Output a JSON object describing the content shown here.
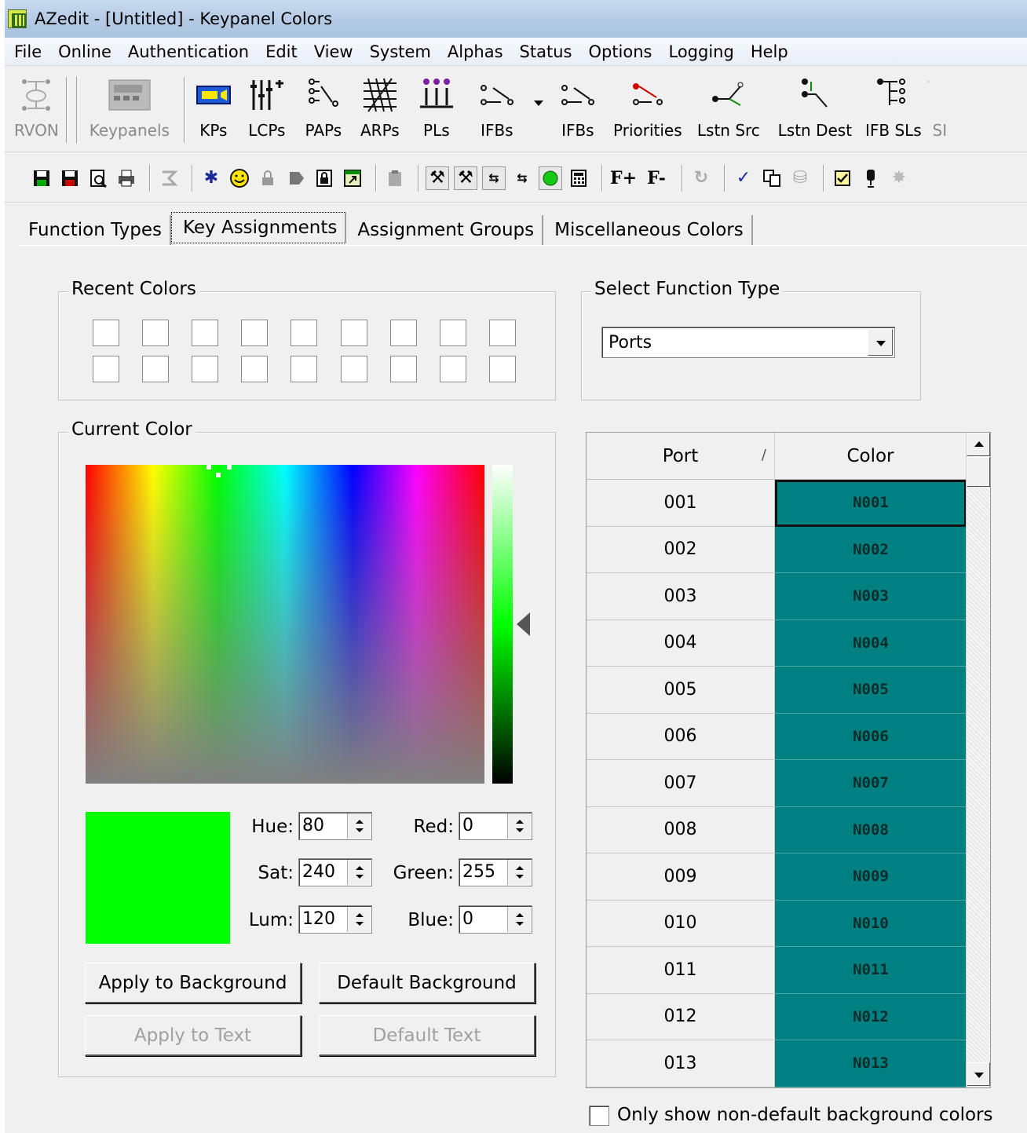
{
  "window": {
    "title": "AZedit - [Untitled] - Keypanel Colors"
  },
  "menu": [
    "File",
    "Online",
    "Authentication",
    "Edit",
    "View",
    "System",
    "Alphas",
    "Status",
    "Options",
    "Logging",
    "Help"
  ],
  "toolbar": {
    "buttons": [
      {
        "label": "RVON",
        "icon": "rvon-icon",
        "enabled": false
      },
      {
        "label": "Keypanels",
        "icon": "keypanels-icon",
        "enabled": false
      },
      {
        "label": "KPs",
        "icon": "kps-icon",
        "enabled": true
      },
      {
        "label": "LCPs",
        "icon": "lcps-icon",
        "enabled": true
      },
      {
        "label": "PAPs",
        "icon": "paps-icon",
        "enabled": true
      },
      {
        "label": "ARPs",
        "icon": "arps-icon",
        "enabled": true
      },
      {
        "label": "PLs",
        "icon": "pls-icon",
        "enabled": true
      },
      {
        "label": "IFBs",
        "icon": "ifbs-icon",
        "enabled": true
      },
      {
        "label": "IFBs",
        "icon": "ifbs-icon",
        "enabled": true
      },
      {
        "label": "Priorities",
        "icon": "priorities-icon",
        "enabled": true
      },
      {
        "label": "Lstn Src",
        "icon": "listen-source-icon",
        "enabled": true
      },
      {
        "label": "Lstn Dest",
        "icon": "listen-dest-icon",
        "enabled": true
      },
      {
        "label": "IFB SLs",
        "icon": "ifb-sls-icon",
        "enabled": true
      },
      {
        "label": "SI",
        "icon": "cut-off-icon",
        "enabled": false
      }
    ]
  },
  "small_toolbar": {
    "icons": [
      "save-icon",
      "save-as-icon",
      "print-preview-icon",
      "print-icon",
      "online-icon",
      "gear-icon",
      "smiley-icon",
      "lock-icon",
      "shape-icon",
      "locked-file-icon",
      "export-icon",
      "clipboard-icon",
      "hammer-icon",
      "hammer-add-icon",
      "routing-icon",
      "routing-add-icon",
      "green-dot-icon",
      "calculator-icon",
      "f-plus-icon",
      "f-minus-icon",
      "refresh-icon",
      "spellcheck-icon",
      "translate-icon",
      "server-icon",
      "checkbox-icon",
      "microphone-icon",
      "burst-icon"
    ],
    "text_buttons": {
      "f_plus": "F+",
      "f_minus": "F-"
    }
  },
  "tabs": [
    {
      "label": "Function Types",
      "active": false
    },
    {
      "label": "Key Assignments",
      "active": true
    },
    {
      "label": "Assignment Groups",
      "active": false
    },
    {
      "label": "Miscellaneous Colors",
      "active": false
    }
  ],
  "recent_colors": {
    "title": "Recent Colors",
    "count": 18
  },
  "select_function_type": {
    "title": "Select Function Type",
    "value": "Ports"
  },
  "current_color": {
    "title": "Current Color",
    "preview_color": "#00ff00",
    "hue_label": "Hue:",
    "hue": "80",
    "sat_label": "Sat:",
    "sat": "240",
    "lum_label": "Lum:",
    "lum": "120",
    "red_label": "Red:",
    "red": "0",
    "green_label": "Green:",
    "green": "255",
    "blue_label": "Blue:",
    "blue": "0",
    "apply_bg": "Apply to Background",
    "default_bg": "Default Background",
    "apply_text": "Apply to Text",
    "default_text": "Default Text"
  },
  "table": {
    "columns": [
      "Port",
      "Color"
    ],
    "sort_indicator": "/",
    "rows": [
      {
        "port": "001",
        "color": "N001"
      },
      {
        "port": "002",
        "color": "N002"
      },
      {
        "port": "003",
        "color": "N003"
      },
      {
        "port": "004",
        "color": "N004"
      },
      {
        "port": "005",
        "color": "N005"
      },
      {
        "port": "006",
        "color": "N006"
      },
      {
        "port": "007",
        "color": "N007"
      },
      {
        "port": "008",
        "color": "N008"
      },
      {
        "port": "009",
        "color": "N009"
      },
      {
        "port": "010",
        "color": "N010"
      },
      {
        "port": "011",
        "color": "N011"
      },
      {
        "port": "012",
        "color": "N012"
      },
      {
        "port": "013",
        "color": "N013"
      }
    ],
    "row_color": "#008080"
  },
  "only_nondefault_label": "Only show non-default background colors"
}
